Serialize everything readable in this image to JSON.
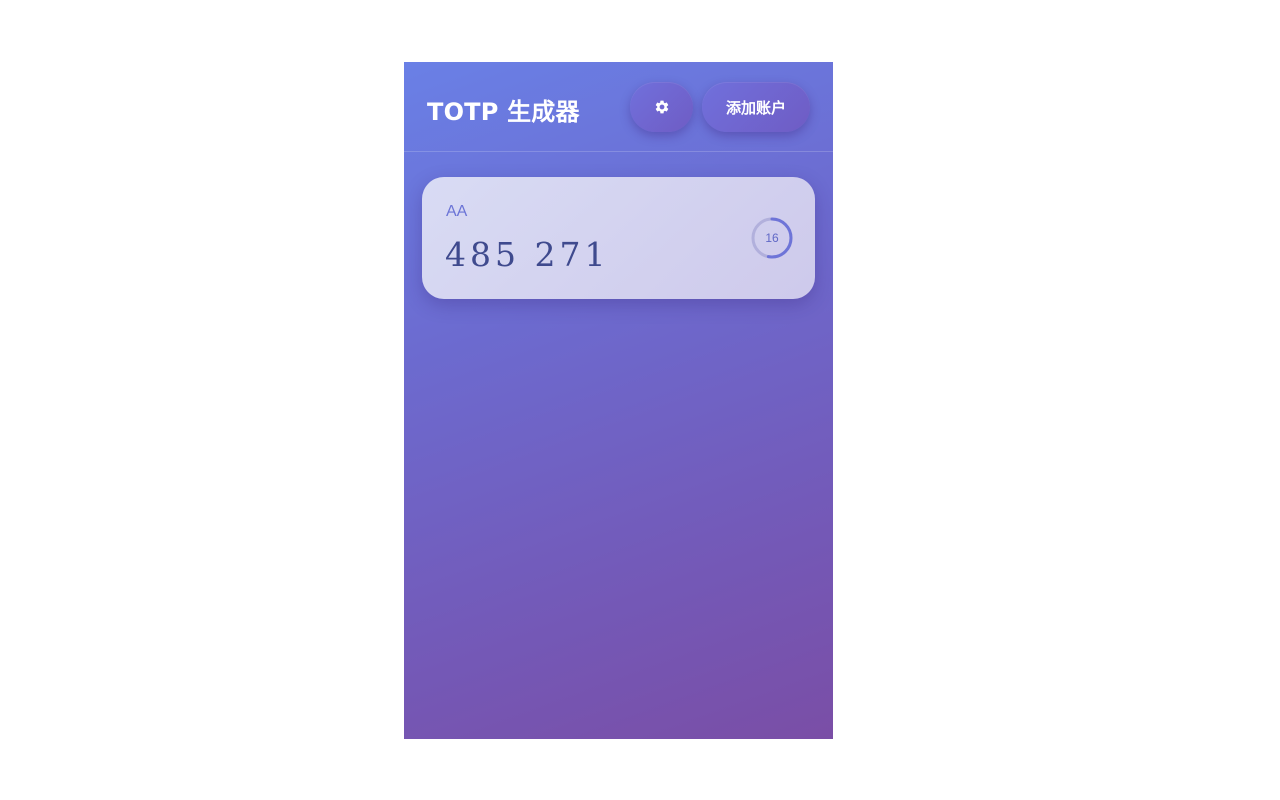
{
  "header": {
    "title": "TOTP 生成器",
    "settings_icon": "gear-icon",
    "add_account_label": "添加账户"
  },
  "accounts": [
    {
      "name": "AA",
      "code": "485 271",
      "seconds_remaining": "16",
      "progress_fraction": 0.53
    }
  ],
  "colors": {
    "gradient_start": "#6a80e6",
    "gradient_end": "#7a4ea6",
    "code_text": "#3f4a8e",
    "account_text": "#6b74d6",
    "timer_ring": "#6e74d8"
  }
}
